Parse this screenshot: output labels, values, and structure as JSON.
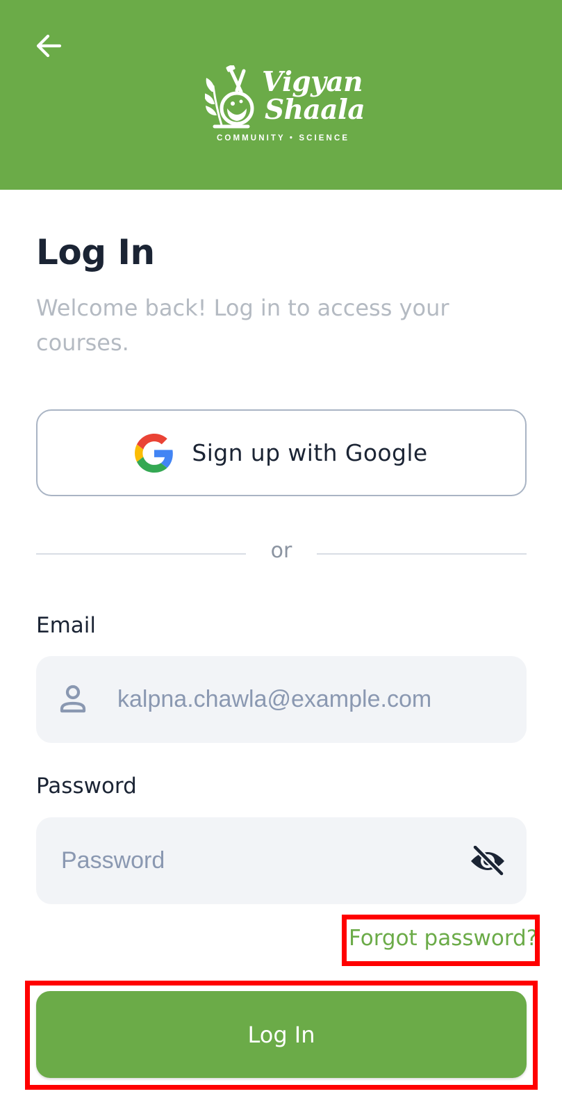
{
  "header": {
    "background_color": "#6bab48",
    "back_icon": "arrow-left-icon",
    "logo": {
      "line1": "Vigyan",
      "line2": "Shaala",
      "tagline": "COMMUNITY • SCIENCE"
    }
  },
  "page": {
    "title": "Log In",
    "subtitle": "Welcome back! Log in to access your courses."
  },
  "google_button": {
    "label": "Sign up with Google",
    "icon": "google-g-icon"
  },
  "divider": {
    "text": "or"
  },
  "email": {
    "label": "Email",
    "placeholder": "kalpna.chawla@example.com",
    "value": "",
    "icon": "user-icon"
  },
  "password": {
    "label": "Password",
    "placeholder": "Password",
    "value": "",
    "toggle_icon": "eye-off-icon"
  },
  "forgot_password": {
    "label": "Forgot password?"
  },
  "login_button": {
    "label": "Log In"
  },
  "colors": {
    "accent": "#6bab48",
    "highlight": "#ff0000",
    "input_bg": "#f2f4f7"
  }
}
